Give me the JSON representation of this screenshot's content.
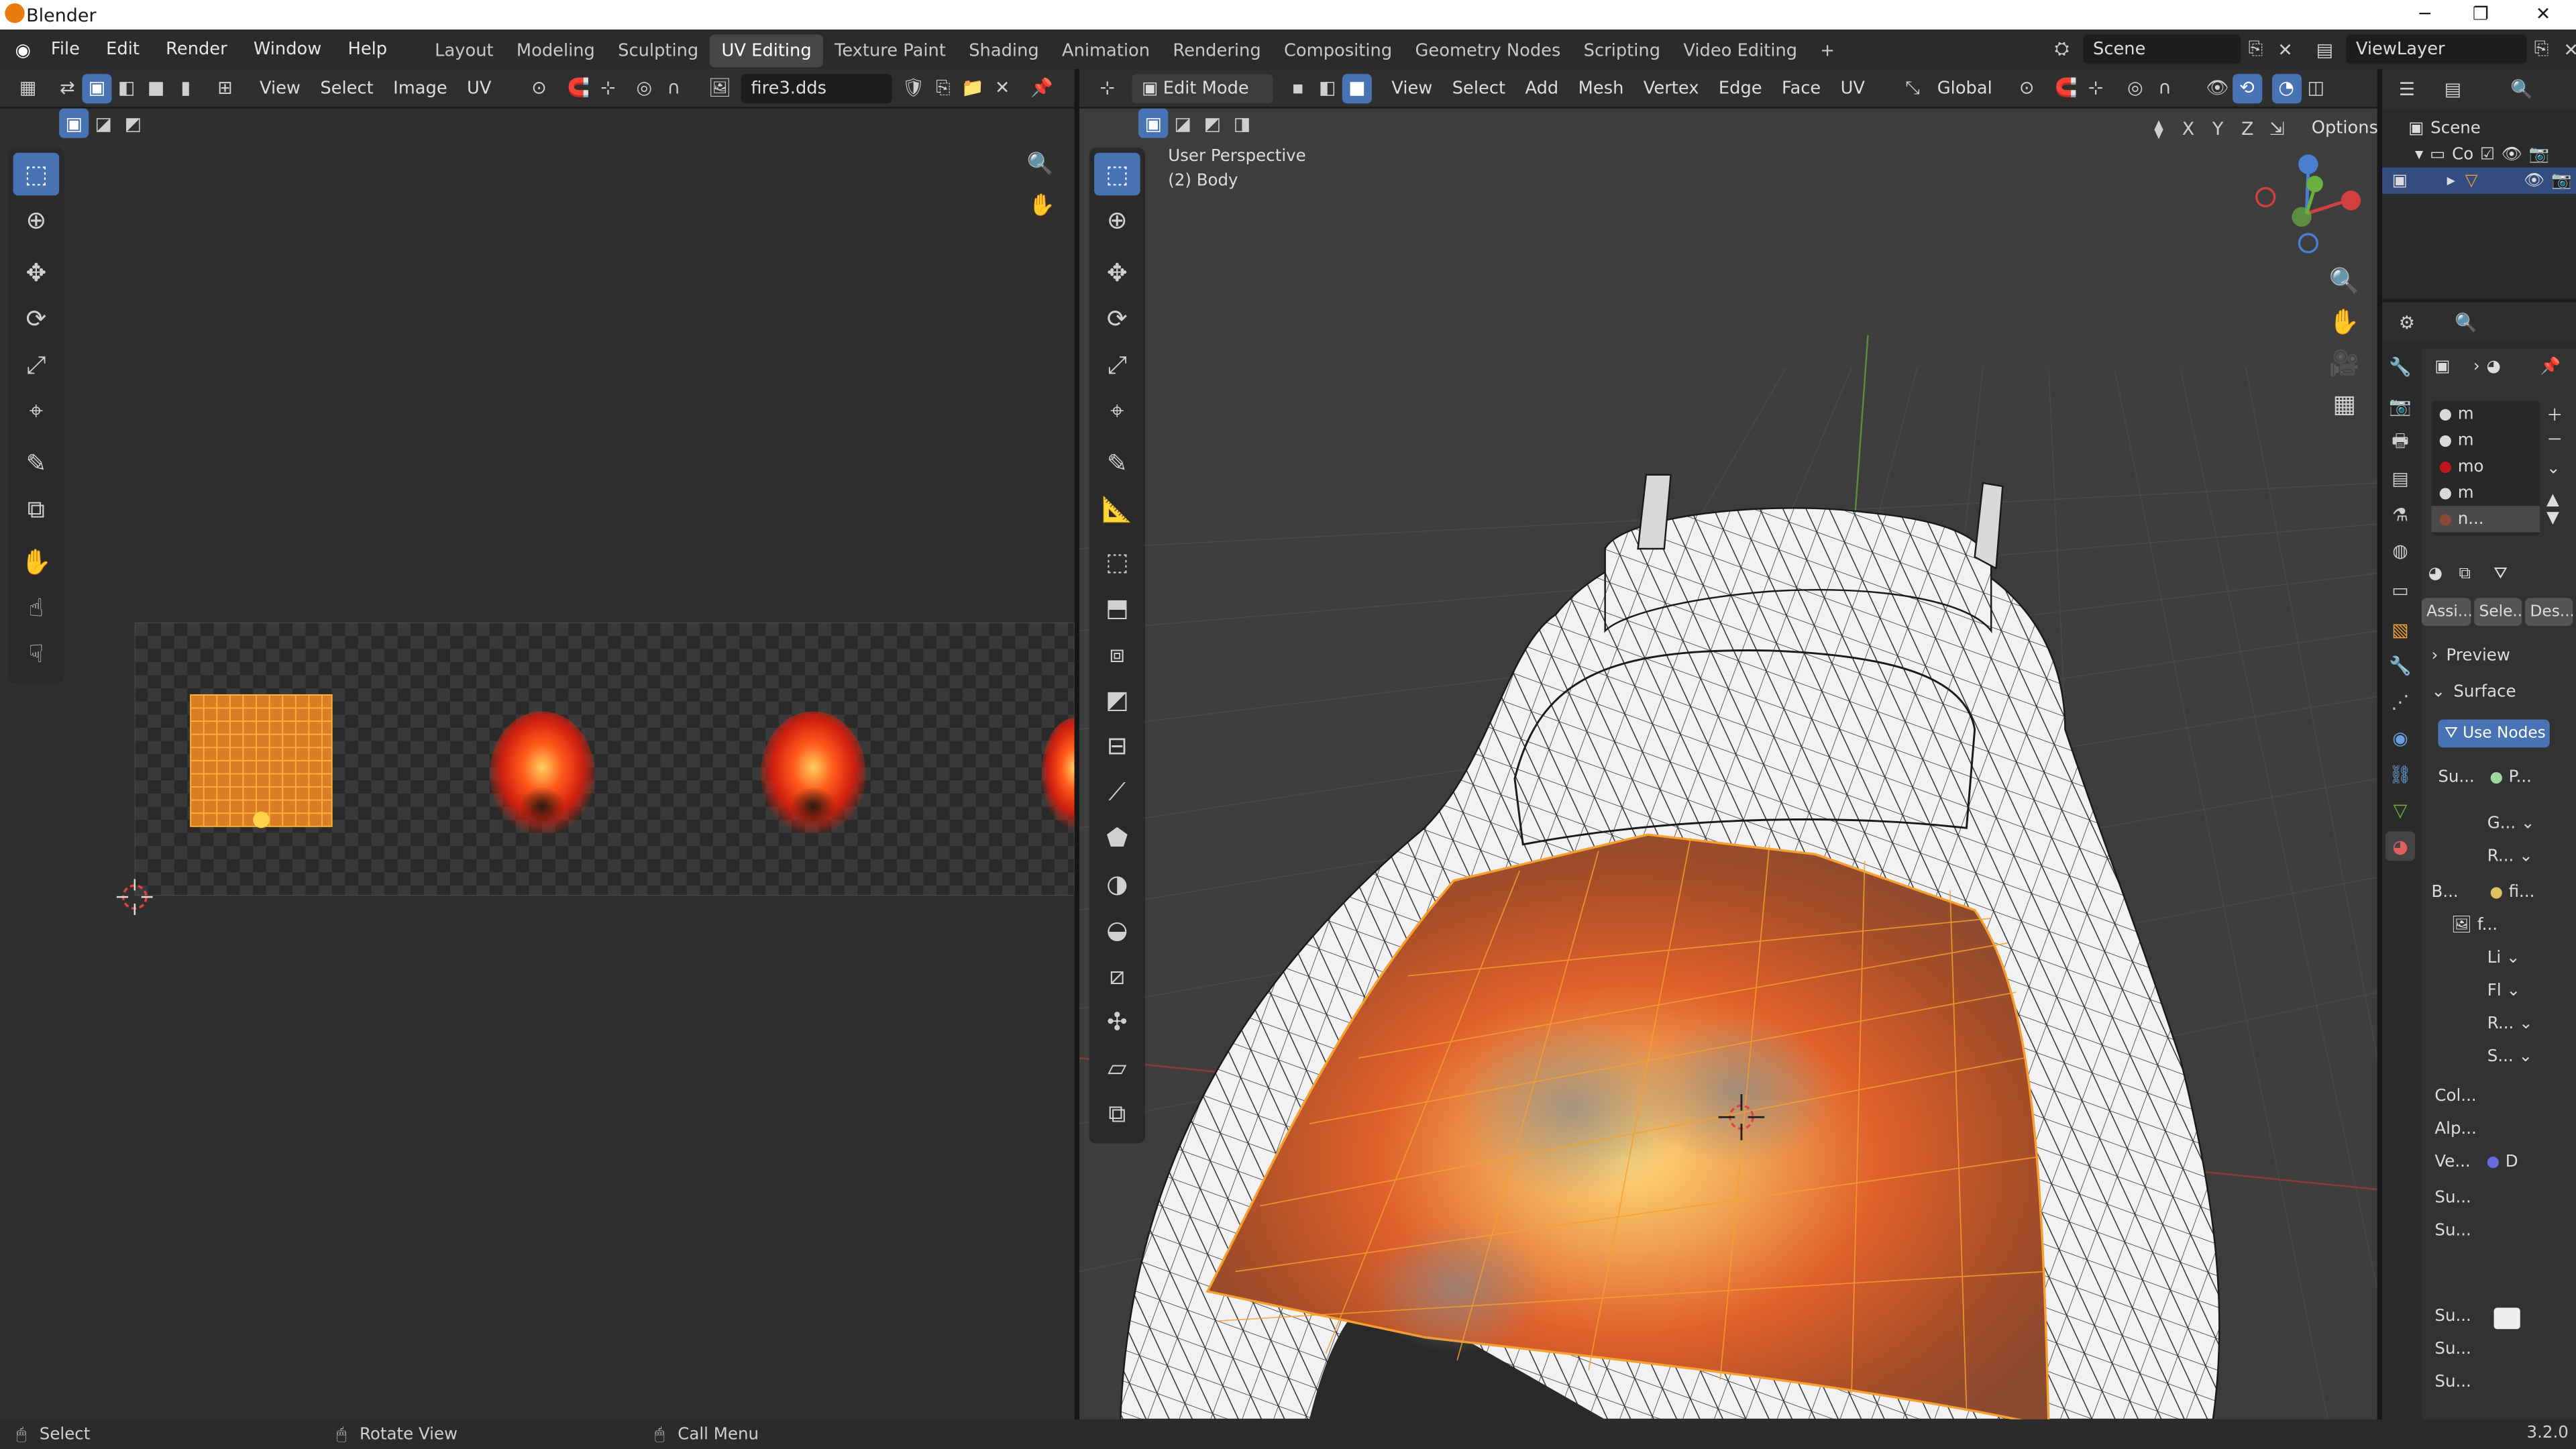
{
  "app": {
    "title": "Blender",
    "version": "3.2.0"
  },
  "menu": {
    "file": "File",
    "edit": "Edit",
    "render": "Render",
    "window": "Window",
    "help": "Help"
  },
  "workspaces": [
    {
      "label": "Layout"
    },
    {
      "label": "Modeling"
    },
    {
      "label": "Sculpting"
    },
    {
      "label": "UV Editing",
      "active": true
    },
    {
      "label": "Texture Paint"
    },
    {
      "label": "Shading"
    },
    {
      "label": "Animation"
    },
    {
      "label": "Rendering"
    },
    {
      "label": "Compositing"
    },
    {
      "label": "Geometry Nodes"
    },
    {
      "label": "Scripting"
    },
    {
      "label": "Video Editing"
    }
  ],
  "scene": {
    "name": "Scene",
    "view_layer": "ViewLayer"
  },
  "uv_editor": {
    "menus": {
      "view": "View",
      "select": "Select",
      "image": "Image",
      "uv": "UV"
    },
    "image_name": "fire3.dds"
  },
  "viewport": {
    "mode": "Edit Mode",
    "menus": {
      "view": "View",
      "select": "Select",
      "add": "Add",
      "mesh": "Mesh",
      "vertex": "Vertex",
      "edge": "Edge",
      "face": "Face",
      "uv": "UV"
    },
    "orientation": "Global",
    "options": "Options",
    "perspective": "User Perspective",
    "object_info": "(2) Body",
    "axes": {
      "x": "X",
      "y": "Y",
      "z": "Z"
    }
  },
  "outliner": {
    "scene_label": "Scene",
    "collection_label": "Co"
  },
  "properties": {
    "materials": [
      {
        "name": "m",
        "color": "#d9d9d9"
      },
      {
        "name": "m",
        "color": "#d9d9d9"
      },
      {
        "name": "mo",
        "color": "#c0141e"
      },
      {
        "name": "m",
        "color": "#d9d9d9"
      },
      {
        "name": "n...",
        "color": "#8a4a3a",
        "selected": true
      }
    ],
    "slot_buttons": {
      "assign": "Assi...",
      "select": "Sele...",
      "deselect": "Des..."
    },
    "preview": "Preview",
    "surface": "Surface",
    "use_nodes": "Use Nodes",
    "rows": [
      {
        "label": "Su...",
        "value": "P..."
      },
      {
        "label": "",
        "value": "G..."
      },
      {
        "label": "",
        "value": "R..."
      },
      {
        "label": "B...",
        "value": "fi..."
      },
      {
        "label": "",
        "value": "f..."
      },
      {
        "label": "",
        "value": "Li"
      },
      {
        "label": "",
        "value": "Fl"
      },
      {
        "label": "",
        "value": "R..."
      },
      {
        "label": "",
        "value": "S..."
      },
      {
        "label": "Col...",
        "value": ""
      },
      {
        "label": "Alp...",
        "value": ""
      },
      {
        "label": "Ve...",
        "value": "D"
      },
      {
        "label": "Su...",
        "value": ""
      },
      {
        "label": "Su...",
        "value": ""
      },
      {
        "label": "Su...",
        "value": ""
      },
      {
        "label": "Su...",
        "value": ""
      },
      {
        "label": "Su...",
        "value": ""
      }
    ]
  },
  "statusbar": {
    "select": "Select",
    "rotate": "Rotate View",
    "call_menu": "Call Menu",
    "version": "3.2.0"
  },
  "colors": {
    "accent": "#4772b3",
    "background": "#1d1d1d",
    "grid": "#393939",
    "uv_orange": "#f5a030"
  }
}
